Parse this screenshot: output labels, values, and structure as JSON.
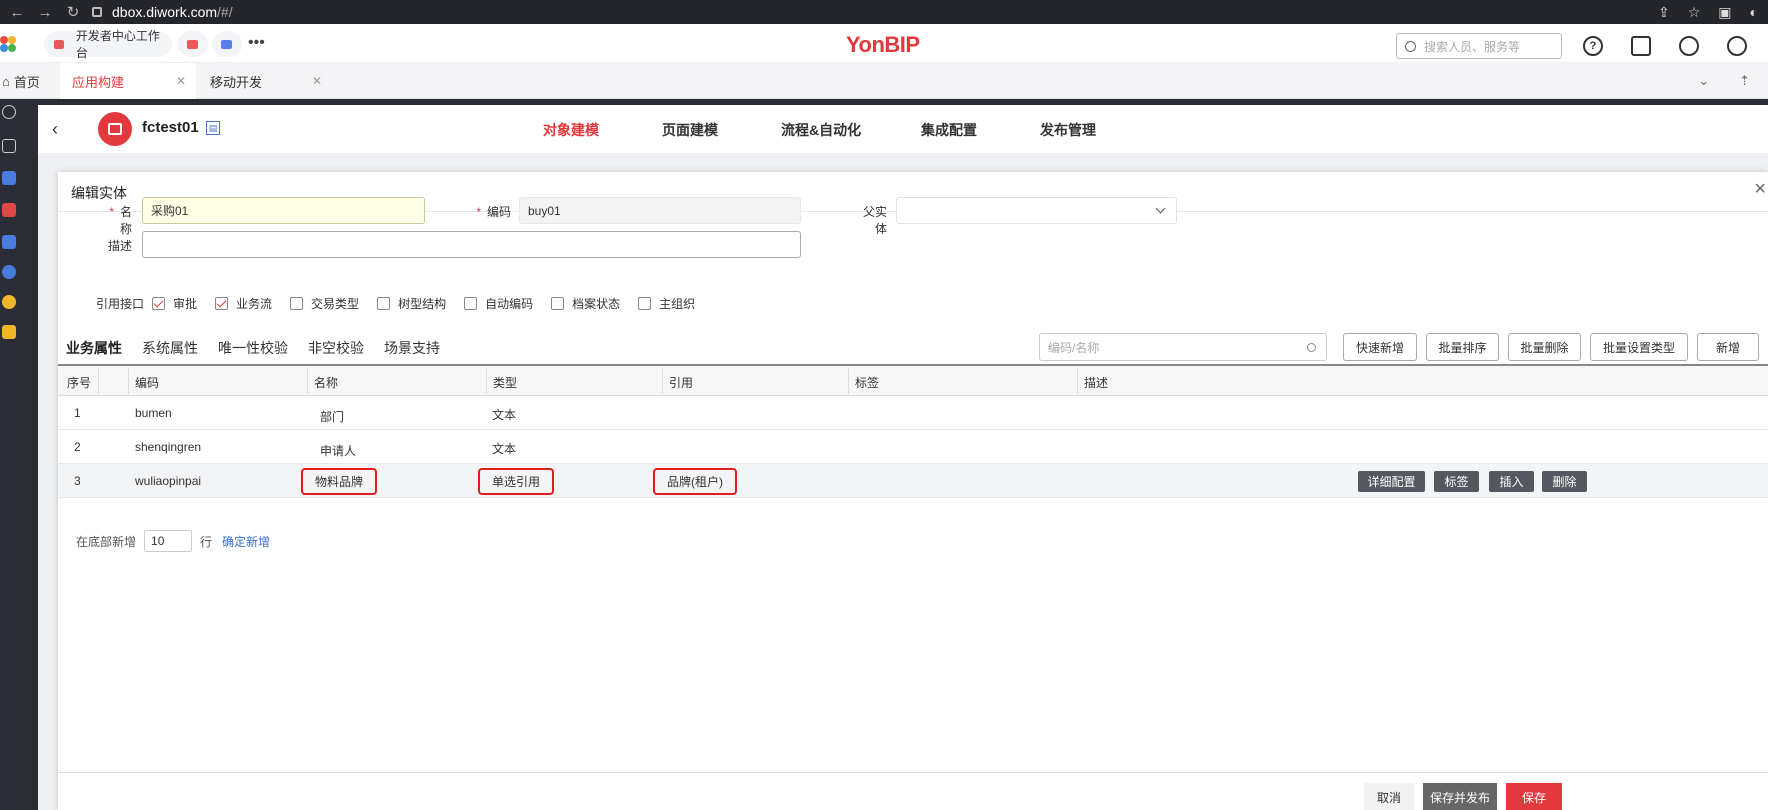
{
  "browser": {
    "host": "dbox.diwork.com",
    "path": "/#/"
  },
  "header": {
    "tabs": [
      {
        "label": "开发者中心工作台"
      }
    ],
    "brand": "YonBIP",
    "search_placeholder": "搜索人员、服务等"
  },
  "page_tabs": {
    "home": "首页",
    "app": "应用构建",
    "mobile": "移动开发"
  },
  "project": {
    "name": "fctest01",
    "nav": [
      "对象建模",
      "页面建模",
      "流程&自动化",
      "集成配置",
      "发布管理"
    ]
  },
  "modal": {
    "title": "编辑实体",
    "form": {
      "name_label": "名称",
      "name_value": "采购01",
      "code_label": "编码",
      "code_value": "buy01",
      "parent_label": "父实体",
      "parent_value": "",
      "desc_label": "描述",
      "desc_value": "",
      "iface_label": "引用接口"
    },
    "interfaces": [
      {
        "label": "审批",
        "checked": true
      },
      {
        "label": "业务流",
        "checked": true
      },
      {
        "label": "交易类型",
        "checked": false
      },
      {
        "label": "树型结构",
        "checked": false
      },
      {
        "label": "自动编码",
        "checked": false
      },
      {
        "label": "档案状态",
        "checked": false
      },
      {
        "label": "主组织",
        "checked": false
      }
    ],
    "sub_tabs": [
      "业务属性",
      "系统属性",
      "唯一性校验",
      "非空校验",
      "场景支持"
    ],
    "toolbar": {
      "search_placeholder": "编码/名称",
      "quick_add": "快速新增",
      "batch_sort": "批量排序",
      "batch_delete": "批量删除",
      "batch_type": "批量设置类型",
      "add": "新增"
    },
    "table": {
      "columns": [
        "序号",
        "编码",
        "名称",
        "类型",
        "引用",
        "标签",
        "描述"
      ],
      "rows": [
        {
          "no": "1",
          "code": "bumen",
          "name": "部门",
          "type": "文本",
          "ref": ""
        },
        {
          "no": "2",
          "code": "shenqingren",
          "name": "申请人",
          "type": "文本",
          "ref": ""
        },
        {
          "no": "3",
          "code": "wuliaopinpai",
          "name": "物料品牌",
          "type": "单选引用",
          "ref": "品牌(租户)"
        }
      ],
      "row_actions": [
        "详细配置",
        "标签",
        "插入",
        "删除"
      ]
    },
    "add_bottom": {
      "prefix": "在底部新增",
      "count": "10",
      "unit": "行",
      "confirm": "确定新增"
    },
    "footer": {
      "cancel": "取消",
      "save_publish": "保存并发布",
      "save": "保存"
    }
  },
  "colors": {
    "brand": "#e4393c",
    "highlight_box": "#e01e1e"
  }
}
